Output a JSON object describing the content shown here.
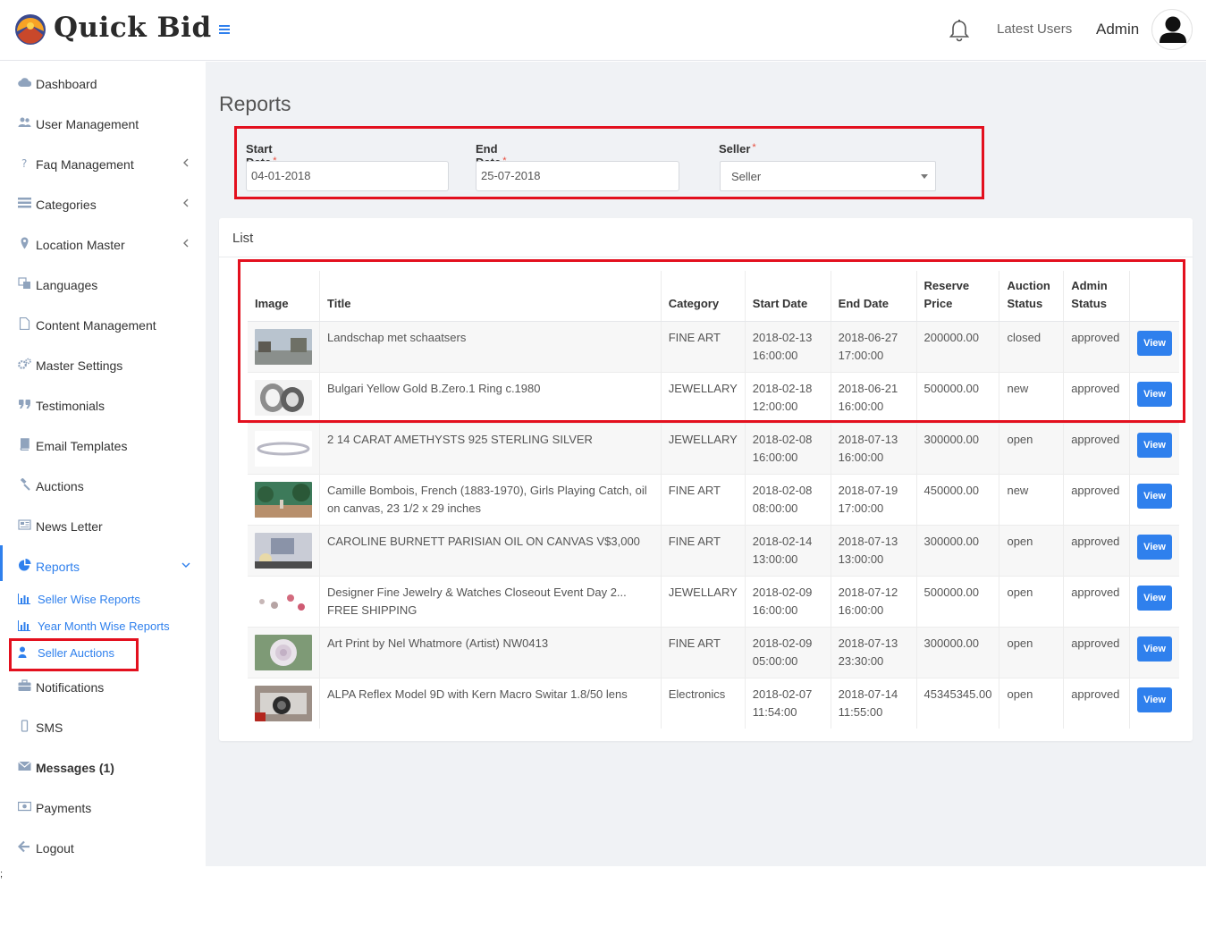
{
  "brand": {
    "name": "Quick Bid"
  },
  "header": {
    "latest_users": "Latest Users",
    "admin": "Admin"
  },
  "sidebar": {
    "items": [
      {
        "label": "Dashboard",
        "icon": "cloud-icon"
      },
      {
        "label": "User Management",
        "icon": "users-icon"
      },
      {
        "label": "Faq Management",
        "icon": "question-icon"
      },
      {
        "label": "Categories",
        "icon": "list-icon"
      },
      {
        "label": "Location Master",
        "icon": "map-marker-icon"
      },
      {
        "label": "Languages",
        "icon": "language-icon"
      },
      {
        "label": "Content Management",
        "icon": "file-icon"
      },
      {
        "label": "Master Settings",
        "icon": "cogs-icon"
      },
      {
        "label": "Testimonials",
        "icon": "quote-icon"
      },
      {
        "label": "Email Templates",
        "icon": "book-icon"
      },
      {
        "label": "Auctions",
        "icon": "gavel-icon"
      },
      {
        "label": "News Letter",
        "icon": "newspaper-icon"
      },
      {
        "label": "Reports",
        "icon": "pie-chart-icon"
      }
    ],
    "sub_items": [
      {
        "label": "Seller Wise Reports",
        "icon": "bar-chart-icon"
      },
      {
        "label": "Year Month Wise Reports",
        "icon": "bar-chart-icon"
      },
      {
        "label": "Seller Auctions",
        "icon": "user-icon"
      }
    ],
    "bottom_items": [
      {
        "label": "Notifications",
        "icon": "briefcase-icon"
      },
      {
        "label": "SMS",
        "icon": "mobile-icon"
      },
      {
        "label": "Messages (1)",
        "icon": "envelope-icon"
      },
      {
        "label": "Payments",
        "icon": "money-icon"
      },
      {
        "label": "Logout",
        "icon": "arrow-left-icon"
      }
    ]
  },
  "page": {
    "title": "Reports",
    "filters": {
      "start_date_label": "Start Date",
      "start_date_value": "04-01-2018",
      "end_date_label": "End Date",
      "end_date_value": "25-07-2018",
      "seller_label": "Seller",
      "seller_value": "Seller",
      "required_mark": "*"
    },
    "list_title": "List",
    "table": {
      "headers": [
        "Image",
        "Title",
        "Category",
        "Start Date",
        "End Date",
        "Reserve Price",
        "Auction Status",
        "Admin Status"
      ],
      "view_label": "View",
      "rows": [
        {
          "title": "Landschap met schaatsers",
          "category": "FINE ART",
          "start": "2018-02-13 16:00:00",
          "end": "2018-06-27 17:00:00",
          "price": "200000.00",
          "auction_status": "closed",
          "admin_status": "approved"
        },
        {
          "title": "Bulgari Yellow Gold B.Zero.1 Ring c.1980",
          "category": "JEWELLARY",
          "start": "2018-02-18 12:00:00",
          "end": "2018-06-21 16:00:00",
          "price": "500000.00",
          "auction_status": "new",
          "admin_status": "approved"
        },
        {
          "title": "2 14 CARAT AMETHYSTS 925 STERLING SILVER",
          "category": "JEWELLARY",
          "start": "2018-02-08 16:00:00",
          "end": "2018-07-13 16:00:00",
          "price": "300000.00",
          "auction_status": "open",
          "admin_status": "approved"
        },
        {
          "title": "Camille Bombois, French (1883-1970), Girls Playing Catch, oil on canvas, 23 1/2 x 29 inches",
          "category": "FINE ART",
          "start": "2018-02-08 08:00:00",
          "end": "2018-07-19 17:00:00",
          "price": "450000.00",
          "auction_status": "new",
          "admin_status": "approved"
        },
        {
          "title": "CAROLINE BURNETT PARISIAN OIL ON CANVAS V$3,000",
          "category": "FINE ART",
          "start": "2018-02-14 13:00:00",
          "end": "2018-07-13 13:00:00",
          "price": "300000.00",
          "auction_status": "open",
          "admin_status": "approved"
        },
        {
          "title": "Designer Fine Jewelry & Watches Closeout Event Day 2... FREE SHIPPING",
          "category": "JEWELLARY",
          "start": "2018-02-09 16:00:00",
          "end": "2018-07-12 16:00:00",
          "price": "500000.00",
          "auction_status": "open",
          "admin_status": "approved"
        },
        {
          "title": "Art Print by Nel Whatmore (Artist) NW0413",
          "category": "FINE ART",
          "start": "2018-02-09 05:00:00",
          "end": "2018-07-13 23:30:00",
          "price": "300000.00",
          "auction_status": "open",
          "admin_status": "approved"
        },
        {
          "title": "ALPA Reflex Model 9D with Kern Macro Switar 1.8/50 lens",
          "category": "Electronics",
          "start": "2018-02-07 11:54:00",
          "end": "2018-07-14 11:55:00",
          "price": "45345345.00",
          "auction_status": "open",
          "admin_status": "approved"
        }
      ]
    }
  },
  "footer_char": ";",
  "colors": {
    "accent": "#2f80ed",
    "highlight": "#e3101e",
    "content_bg": "#f0f2f5"
  }
}
